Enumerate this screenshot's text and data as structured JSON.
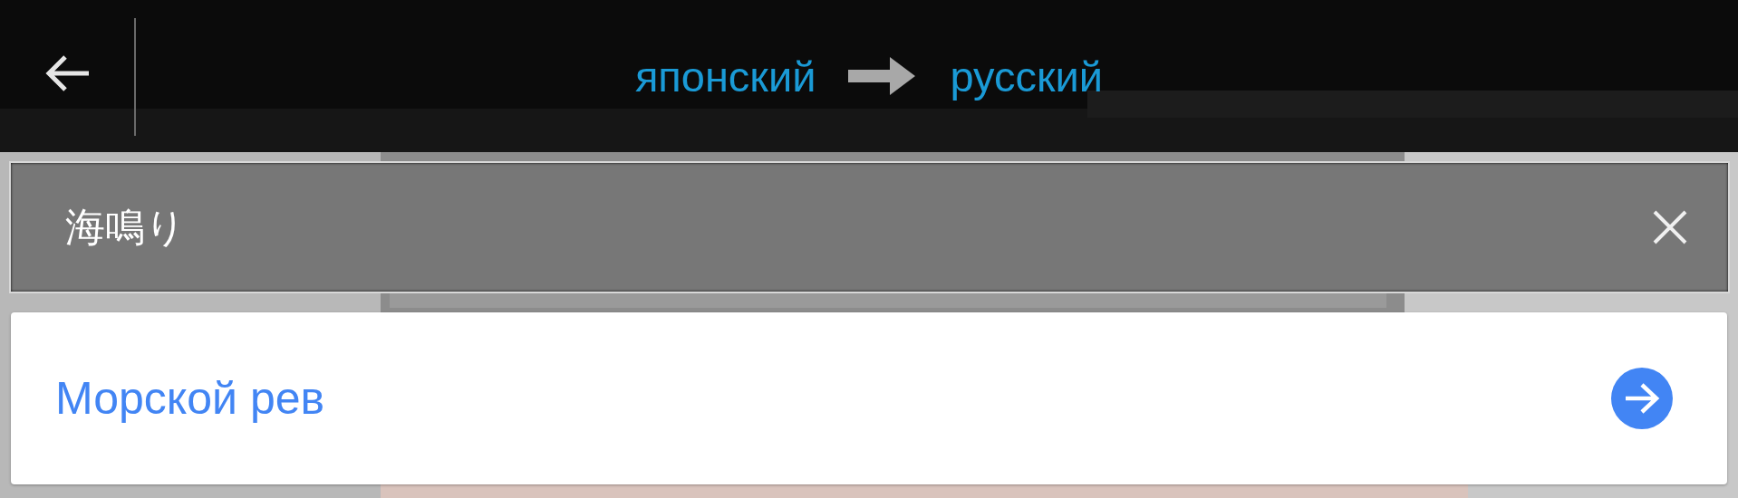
{
  "top_bar": {
    "source_language": "японский",
    "target_language": "русский"
  },
  "input": {
    "value": "海鳴り"
  },
  "result": {
    "text": "Морской рев"
  }
}
